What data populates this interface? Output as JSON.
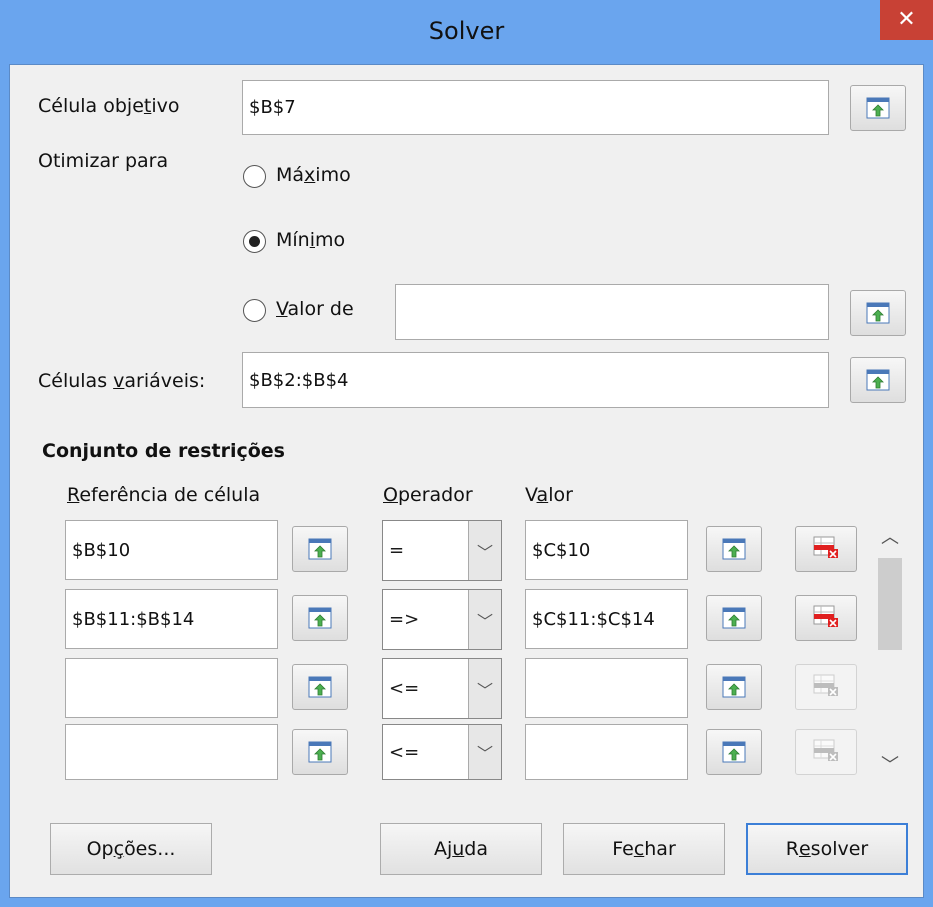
{
  "window": {
    "title": "Solver",
    "close_glyph": "✕"
  },
  "objective": {
    "label_pre": "Célula obje",
    "label_ul": "t",
    "label_post": "ivo",
    "value": "$B$7"
  },
  "optimize": {
    "label": "Otimizar para",
    "max": {
      "pre": "Má",
      "ul": "x",
      "post": "imo",
      "checked": false
    },
    "min": {
      "pre": "Mín",
      "ul": "i",
      "post": "mo",
      "checked": true
    },
    "value_of": {
      "pre": "",
      "ul": "V",
      "post": "alor de",
      "checked": false,
      "value": ""
    }
  },
  "variable_cells": {
    "label_pre": "Células ",
    "label_ul": "v",
    "label_post": "ariáveis:",
    "value": "$B$2:$B$4"
  },
  "constraints": {
    "heading": "Conjunto de restrições",
    "col_ref": {
      "ul": "R",
      "post": "eferência de célula"
    },
    "col_op": {
      "ul": "O",
      "post": "perador"
    },
    "col_val": {
      "pre": "V",
      "ul": "a",
      "post": "lor"
    },
    "rows": [
      {
        "ref": "$B$10",
        "op": "=",
        "value": "$C$10",
        "delete_enabled": true
      },
      {
        "ref": "$B$11:$B$14",
        "op": "=>",
        "value": "$C$11:$C$14",
        "delete_enabled": true
      },
      {
        "ref": "",
        "op": "<=",
        "value": "",
        "delete_enabled": false
      },
      {
        "ref": "",
        "op": "<=",
        "value": "",
        "delete_enabled": false
      }
    ]
  },
  "buttons": {
    "options": {
      "pre": "Op",
      "ul": "ç",
      "post": "ões..."
    },
    "help": {
      "pre": "Aj",
      "ul": "u",
      "post": "da"
    },
    "close": {
      "pre": "Fe",
      "ul": "c",
      "post": "har"
    },
    "solve": {
      "pre": "R",
      "ul": "e",
      "post": "solver"
    }
  },
  "colors": {
    "titlebar": "#6aa5ee",
    "close": "#c84135",
    "dialog_bg": "#f0f0f0"
  }
}
